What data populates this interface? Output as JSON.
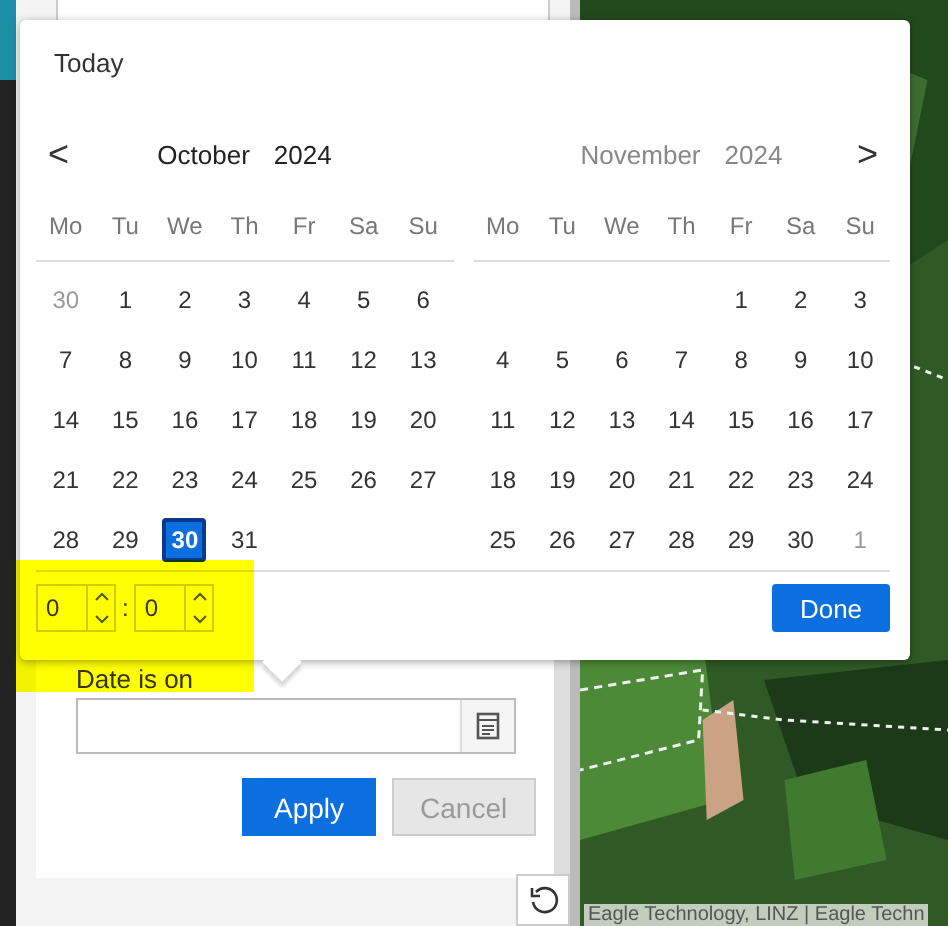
{
  "popup": {
    "today": "Today",
    "prev": "<",
    "next": ">",
    "months": [
      {
        "month": "October",
        "year": "2024",
        "active": true,
        "weekdays": [
          "Mo",
          "Tu",
          "We",
          "Th",
          "Fr",
          "Sa",
          "Su"
        ],
        "weeks": [
          [
            {
              "day": "30",
              "outside": true,
              "selected": false
            },
            {
              "day": "1",
              "outside": false,
              "selected": false
            },
            {
              "day": "2",
              "outside": false,
              "selected": false
            },
            {
              "day": "3",
              "outside": false,
              "selected": false
            },
            {
              "day": "4",
              "outside": false,
              "selected": false
            },
            {
              "day": "5",
              "outside": false,
              "selected": false
            },
            {
              "day": "6",
              "outside": false,
              "selected": false
            }
          ],
          [
            {
              "day": "7",
              "outside": false,
              "selected": false
            },
            {
              "day": "8",
              "outside": false,
              "selected": false
            },
            {
              "day": "9",
              "outside": false,
              "selected": false
            },
            {
              "day": "10",
              "outside": false,
              "selected": false
            },
            {
              "day": "11",
              "outside": false,
              "selected": false
            },
            {
              "day": "12",
              "outside": false,
              "selected": false
            },
            {
              "day": "13",
              "outside": false,
              "selected": false
            }
          ],
          [
            {
              "day": "14",
              "outside": false,
              "selected": false
            },
            {
              "day": "15",
              "outside": false,
              "selected": false
            },
            {
              "day": "16",
              "outside": false,
              "selected": false
            },
            {
              "day": "17",
              "outside": false,
              "selected": false
            },
            {
              "day": "18",
              "outside": false,
              "selected": false
            },
            {
              "day": "19",
              "outside": false,
              "selected": false
            },
            {
              "day": "20",
              "outside": false,
              "selected": false
            }
          ],
          [
            {
              "day": "21",
              "outside": false,
              "selected": false
            },
            {
              "day": "22",
              "outside": false,
              "selected": false
            },
            {
              "day": "23",
              "outside": false,
              "selected": false
            },
            {
              "day": "24",
              "outside": false,
              "selected": false
            },
            {
              "day": "25",
              "outside": false,
              "selected": false
            },
            {
              "day": "26",
              "outside": false,
              "selected": false
            },
            {
              "day": "27",
              "outside": false,
              "selected": false
            }
          ],
          [
            {
              "day": "28",
              "outside": false,
              "selected": false
            },
            {
              "day": "29",
              "outside": false,
              "selected": false
            },
            {
              "day": "30",
              "outside": false,
              "selected": true
            },
            {
              "day": "31",
              "outside": false,
              "selected": false
            }
          ]
        ]
      },
      {
        "month": "November",
        "year": "2024",
        "active": false,
        "weekdays": [
          "Mo",
          "Tu",
          "We",
          "Th",
          "Fr",
          "Sa",
          "Su"
        ],
        "weeks": [
          [
            {
              "day": "1",
              "outside": false,
              "selected": false
            },
            {
              "day": "2",
              "outside": false,
              "selected": false
            },
            {
              "day": "3",
              "outside": false,
              "selected": false
            }
          ],
          [
            {
              "day": "4",
              "outside": false,
              "selected": false
            },
            {
              "day": "5",
              "outside": false,
              "selected": false
            },
            {
              "day": "6",
              "outside": false,
              "selected": false
            },
            {
              "day": "7",
              "outside": false,
              "selected": false
            },
            {
              "day": "8",
              "outside": false,
              "selected": false
            },
            {
              "day": "9",
              "outside": false,
              "selected": false
            },
            {
              "day": "10",
              "outside": false,
              "selected": false
            }
          ],
          [
            {
              "day": "11",
              "outside": false,
              "selected": false
            },
            {
              "day": "12",
              "outside": false,
              "selected": false
            },
            {
              "day": "13",
              "outside": false,
              "selected": false
            },
            {
              "day": "14",
              "outside": false,
              "selected": false
            },
            {
              "day": "15",
              "outside": false,
              "selected": false
            },
            {
              "day": "16",
              "outside": false,
              "selected": false
            },
            {
              "day": "17",
              "outside": false,
              "selected": false
            }
          ],
          [
            {
              "day": "18",
              "outside": false,
              "selected": false
            },
            {
              "day": "19",
              "outside": false,
              "selected": false
            },
            {
              "day": "20",
              "outside": false,
              "selected": false
            },
            {
              "day": "21",
              "outside": false,
              "selected": false
            },
            {
              "day": "22",
              "outside": false,
              "selected": false
            },
            {
              "day": "23",
              "outside": false,
              "selected": false
            },
            {
              "day": "24",
              "outside": false,
              "selected": false
            }
          ],
          [
            {
              "day": "25",
              "outside": false,
              "selected": false
            },
            {
              "day": "26",
              "outside": false,
              "selected": false
            },
            {
              "day": "27",
              "outside": false,
              "selected": false
            },
            {
              "day": "28",
              "outside": false,
              "selected": false
            },
            {
              "day": "29",
              "outside": false,
              "selected": false
            },
            {
              "day": "30",
              "outside": false,
              "selected": false
            },
            {
              "day": "1",
              "outside": true,
              "selected": false
            }
          ]
        ]
      }
    ],
    "time": {
      "hours": "0",
      "separator": ":",
      "minutes": "0"
    },
    "done": "Done"
  },
  "filter": {
    "label": "Date is on",
    "apply": "Apply",
    "cancel": "Cancel"
  },
  "map": {
    "attribution": "Eagle Technology, LINZ | Eagle Techn"
  }
}
